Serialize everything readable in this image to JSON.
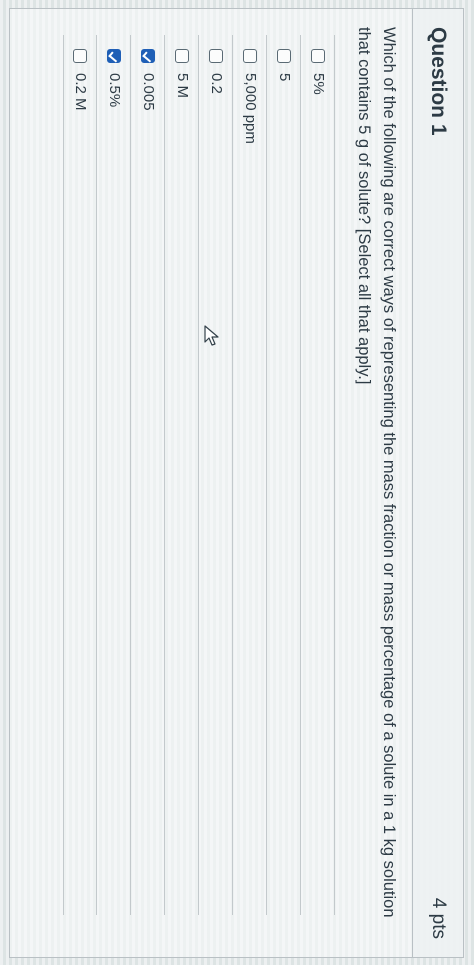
{
  "question": {
    "title": "Question 1",
    "points": "4 pts",
    "text": "Which of the following are correct ways of representing the mass fraction or mass percentage of a solute in a 1 kg solution that contains 5 g of solute? [Select all that apply.]"
  },
  "answers": [
    {
      "label": "5%",
      "checked": false
    },
    {
      "label": "5",
      "checked": false
    },
    {
      "label": "5,000 ppm",
      "checked": false
    },
    {
      "label": "0.2",
      "checked": false
    },
    {
      "label": "5 M",
      "checked": false
    },
    {
      "label": "0.005",
      "checked": true
    },
    {
      "label": "0.5%",
      "checked": true
    },
    {
      "label": "0.2 M",
      "checked": false
    }
  ],
  "colors": {
    "checked_accent": "#1f5fb6",
    "text": "#2d3b45"
  }
}
